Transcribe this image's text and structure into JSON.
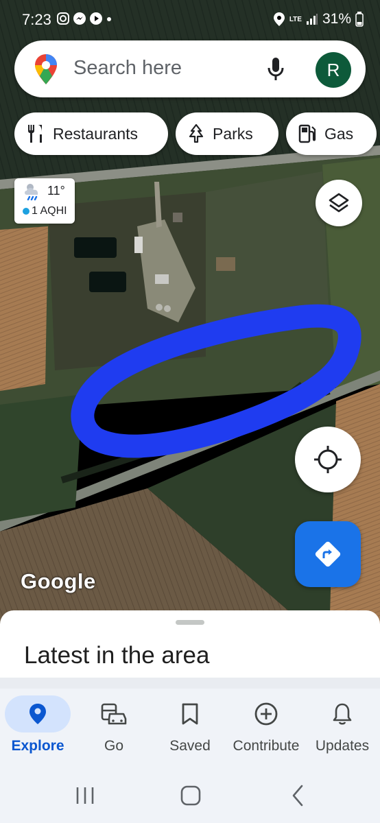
{
  "status_bar": {
    "time": "7:23",
    "network": "LTE",
    "battery": "31%"
  },
  "search": {
    "placeholder": "Search here",
    "avatar_initial": "R",
    "avatar_color": "#0d5a3a"
  },
  "chips": [
    {
      "label": "Restaurants",
      "icon": "fork-knife-icon"
    },
    {
      "label": "Parks",
      "icon": "tree-icon"
    },
    {
      "label": "Gas",
      "icon": "gas-pump-icon"
    }
  ],
  "weather": {
    "temperature": "11°",
    "aqi": "1 AQHI",
    "icon": "rain-cloud-icon"
  },
  "map": {
    "attribution": "Google",
    "annotation_color": "#1f3cf0"
  },
  "sheet": {
    "title": "Latest in the area"
  },
  "bottom_nav": [
    {
      "label": "Explore",
      "icon": "location-pin-icon",
      "active": true
    },
    {
      "label": "Go",
      "icon": "commute-icon",
      "active": false
    },
    {
      "label": "Saved",
      "icon": "bookmark-icon",
      "active": false
    },
    {
      "label": "Contribute",
      "icon": "add-circle-icon",
      "active": false
    },
    {
      "label": "Updates",
      "icon": "bell-icon",
      "active": false
    }
  ],
  "colors": {
    "accent": "#1a73e8",
    "active_nav_pill": "#d3e3fd",
    "active_nav_label": "#0b57d0"
  }
}
